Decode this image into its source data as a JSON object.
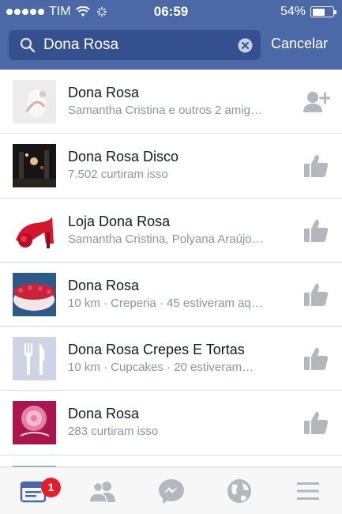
{
  "status_bar": {
    "carrier": "TIM",
    "time": "06:59",
    "battery": "54%"
  },
  "search": {
    "value": "Dona Rosa",
    "cancel_label": "Cancelar"
  },
  "results": [
    {
      "title": "Dona Rosa",
      "subtitle": "Samantha Cristina e outros 2 amig…",
      "action_icon": "add-friend-icon"
    },
    {
      "title": "Dona Rosa Disco",
      "subtitle": "7.502 curtiram isso",
      "action_icon": "like-icon"
    },
    {
      "title": "Loja Dona Rosa",
      "subtitle": "Samantha Cristina, Polyana Araújo…",
      "action_icon": "like-icon"
    },
    {
      "title": "Dona Rosa",
      "subtitle": "10 km · Creperia · 45 estiveram aq…",
      "action_icon": "like-icon"
    },
    {
      "title": "Dona Rosa Crepes E Tortas",
      "subtitle": "10 km · Cupcakes · 20 estiveram…",
      "action_icon": "like-icon"
    },
    {
      "title": "Dona Rosa",
      "subtitle": "283 curtiram isso",
      "action_icon": "like-icon"
    }
  ],
  "tabbar": {
    "feed_badge": "1",
    "tabs": [
      "feed-icon",
      "friends-icon",
      "messenger-icon",
      "globe-icon",
      "menu-icon"
    ]
  },
  "colors": {
    "header": "#4b68a7",
    "search_field": "#35508e",
    "badge": "#e0202e",
    "active_tab": "#4b68a7",
    "inactive_icon": "#b4b7bd"
  }
}
